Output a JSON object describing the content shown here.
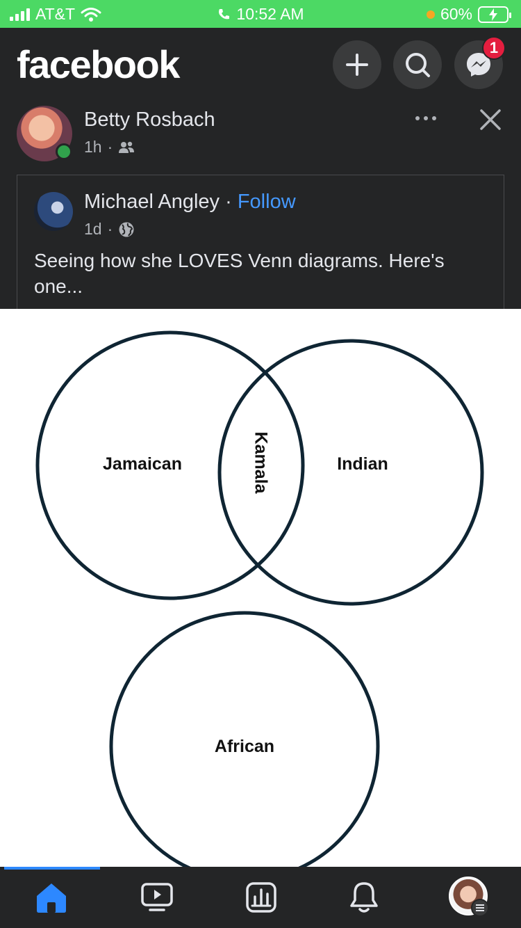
{
  "status_bar": {
    "carrier": "AT&T",
    "time": "10:52 AM",
    "battery": "60%"
  },
  "header": {
    "logo": "facebook",
    "buttons": [
      "plus-icon",
      "search-icon",
      "messenger-icon"
    ],
    "messenger_badge": "1"
  },
  "post": {
    "author": "Betty Rosbach",
    "time": "1h",
    "audience_icon": "friends-icon",
    "shared": {
      "author": "Michael Angley",
      "follow_label": "Follow",
      "time": "1d",
      "audience_icon": "globe-icon",
      "text": "Seeing how she LOVES Venn diagrams. Here's one..."
    }
  },
  "venn": {
    "labels": {
      "left": "Jamaican",
      "right": "Indian",
      "intersection": "Kamala",
      "bottom": "African"
    }
  },
  "bottom_nav": {
    "items": [
      "home-icon",
      "video-icon",
      "feeds-icon",
      "notifications-icon",
      "profile-avatar"
    ],
    "active": "home-icon"
  },
  "colors": {
    "status_green": "#4cd964",
    "background": "#242526",
    "accent_blue": "#2d88ff",
    "follow_blue": "#4599ff",
    "badge_red": "#e41e3f",
    "venn_stroke": "#0f2533"
  }
}
